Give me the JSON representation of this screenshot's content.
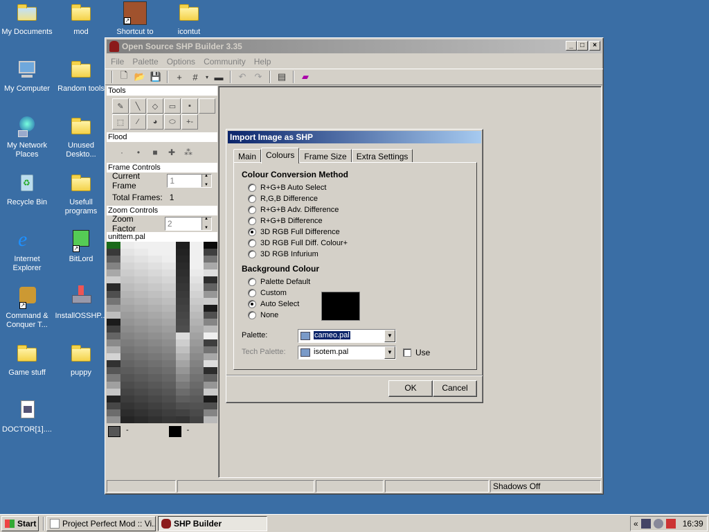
{
  "desktop": {
    "icons": [
      {
        "label": "My Documents"
      },
      {
        "label": "mod"
      },
      {
        "label": "Shortcut to"
      },
      {
        "label": "icontut"
      },
      {
        "label": "My Computer"
      },
      {
        "label": "Random tools"
      },
      {
        "label": "My Network Places"
      },
      {
        "label": "Unused Deskto..."
      },
      {
        "label": "Recycle Bin"
      },
      {
        "label": "Usefull programs"
      },
      {
        "label": "Internet Explorer"
      },
      {
        "label": "BitLord"
      },
      {
        "label": "Command & Conquer T..."
      },
      {
        "label": "InstallOSSHP..."
      },
      {
        "label": "Game stuff"
      },
      {
        "label": "puppy"
      },
      {
        "label": "DOCTOR[1]...."
      }
    ]
  },
  "app": {
    "title": "Open Source SHP Builder 3.35",
    "menu": [
      "File",
      "Palette",
      "Options",
      "Community",
      "Help"
    ],
    "panel": {
      "tools_header": "Tools",
      "flood_header": "Flood",
      "frame_controls_header": "Frame Controls",
      "current_frame_label": "Current Frame",
      "current_frame_value": "1",
      "total_frames_label": "Total Frames:",
      "total_frames_value": "1",
      "zoom_controls_header": "Zoom Controls",
      "zoom_factor_label": "Zoom Factor",
      "zoom_factor_value": "2",
      "palette_name": "unittem.pal",
      "swatch_a_label": "-",
      "swatch_b_label": "-"
    },
    "status": {
      "shadows": "Shadows Off"
    }
  },
  "dialog": {
    "title": "Import Image as SHP",
    "tabs": [
      "Main",
      "Colours",
      "Frame Size",
      "Extra Settings"
    ],
    "active_tab": "Colours",
    "colour_conversion": {
      "header": "Colour Conversion Method",
      "options": [
        {
          "label": "R+G+B Auto Select",
          "checked": false
        },
        {
          "label": "R,G,B Difference",
          "checked": false
        },
        {
          "label": "R+G+B Adv. Difference",
          "checked": false
        },
        {
          "label": "R+G+B Difference",
          "checked": false
        },
        {
          "label": "3D RGB Full Difference",
          "checked": true
        },
        {
          "label": "3D RGB Full Diff. Colour+",
          "checked": false
        },
        {
          "label": "3D RGB Infurium",
          "checked": false
        }
      ]
    },
    "background_colour": {
      "header": "Background Colour",
      "options": [
        {
          "label": "Palette Default",
          "checked": false
        },
        {
          "label": "Custom",
          "checked": false
        },
        {
          "label": "Auto Select",
          "checked": true
        },
        {
          "label": "None",
          "checked": false
        }
      ],
      "swatch_color": "#000000"
    },
    "palette_label": "Palette:",
    "palette_value": "cameo.pal",
    "tech_palette_label": "Tech Palette:",
    "tech_palette_value": "isotem.pal",
    "use_label": "Use",
    "ok_label": "OK",
    "cancel_label": "Cancel"
  },
  "taskbar": {
    "start_label": "Start",
    "items": [
      {
        "label": "Project Perfect Mod :: Vi...",
        "active": false
      },
      {
        "label": "SHP Builder",
        "active": true
      }
    ],
    "tray_expand": "«",
    "clock": "16:39"
  }
}
